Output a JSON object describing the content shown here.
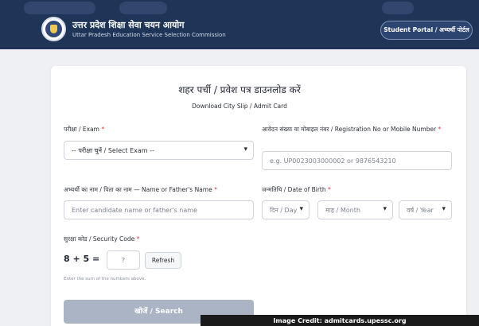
{
  "header": {
    "org_name_hindi": "उत्तर प्रदेश शिक्षा सेवा चयन आयोग",
    "org_name_english": "Uttar Pradesh Education Service Selection Commission",
    "portal_button": "Student Portal / अभ्यर्थी पोर्टल",
    "logo_icon": "emblem-logo-icon",
    "colors": {
      "header_bg": "#1e3557",
      "accent_red": "#d23a3a"
    }
  },
  "form": {
    "title_hindi": "शहर पर्ची / प्रवेश पत्र डाउनलोड करें",
    "title_english": "Download City Slip / Admit Card",
    "exam": {
      "label": "परीक्षा / Exam",
      "required": "*",
      "selected": "-- परीक्षा चुनें / Select Exam --"
    },
    "registration": {
      "label": "आवेदन संख्या या मोबाइल नंबर / Registration No or Mobile Number",
      "required": "*",
      "placeholder": "e.g. UP0023003000002 or 9876543210"
    },
    "name": {
      "label": "अभ्यर्थी का नाम / पिता का नाम — Name or Father's Name",
      "required": "*",
      "placeholder": "Enter candidate name or father's name"
    },
    "dob": {
      "label": "जन्मतिथि / Date of Birth",
      "required": "*",
      "day": "दिन / Day",
      "month": "माह / Month",
      "year": "वर्ष / Year"
    },
    "security": {
      "label": "सुरक्षा कोड / Security Code",
      "required": "*",
      "question": "8 + 5 =",
      "placeholder": "?",
      "refresh": "Refresh",
      "hint": "Enter the sum of the numbers above."
    },
    "search_button": "खोजें / Search"
  },
  "image_credit": "Image Credit: admitcards.upessc.org"
}
